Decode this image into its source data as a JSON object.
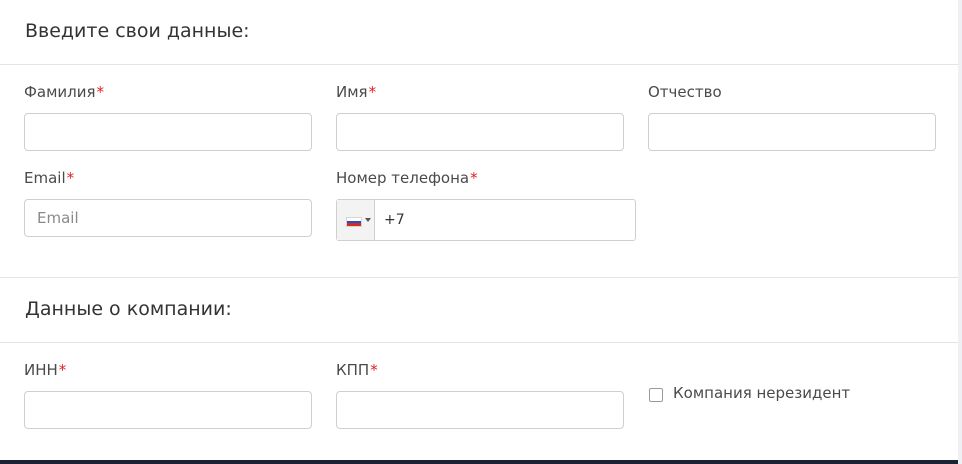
{
  "personal": {
    "title": "Введите свои данные:",
    "last_name": {
      "label": "Фамилия",
      "required": "*",
      "value": ""
    },
    "first_name": {
      "label": "Имя",
      "required": "*",
      "value": ""
    },
    "middle_name": {
      "label": "Отчество",
      "value": ""
    },
    "email": {
      "label": "Email",
      "required": "*",
      "placeholder": "Email",
      "value": ""
    },
    "phone": {
      "label": "Номер телефона",
      "required": "*",
      "value": "+7",
      "country": "RU",
      "flag_icon": "russia-flag-icon",
      "flag_colors": [
        "#ffffff",
        "#1f4fd1",
        "#d52b1e"
      ]
    }
  },
  "company": {
    "title": "Данные о компании:",
    "inn": {
      "label": "ИНН",
      "required": "*",
      "value": ""
    },
    "kpp": {
      "label": "КПП",
      "required": "*",
      "value": ""
    },
    "nonresident": {
      "label": "Компания нерезидент",
      "checked": false
    }
  },
  "colors": {
    "required": "#e02020",
    "border": "#cfcfcf",
    "backdrop": "#1b2233"
  }
}
